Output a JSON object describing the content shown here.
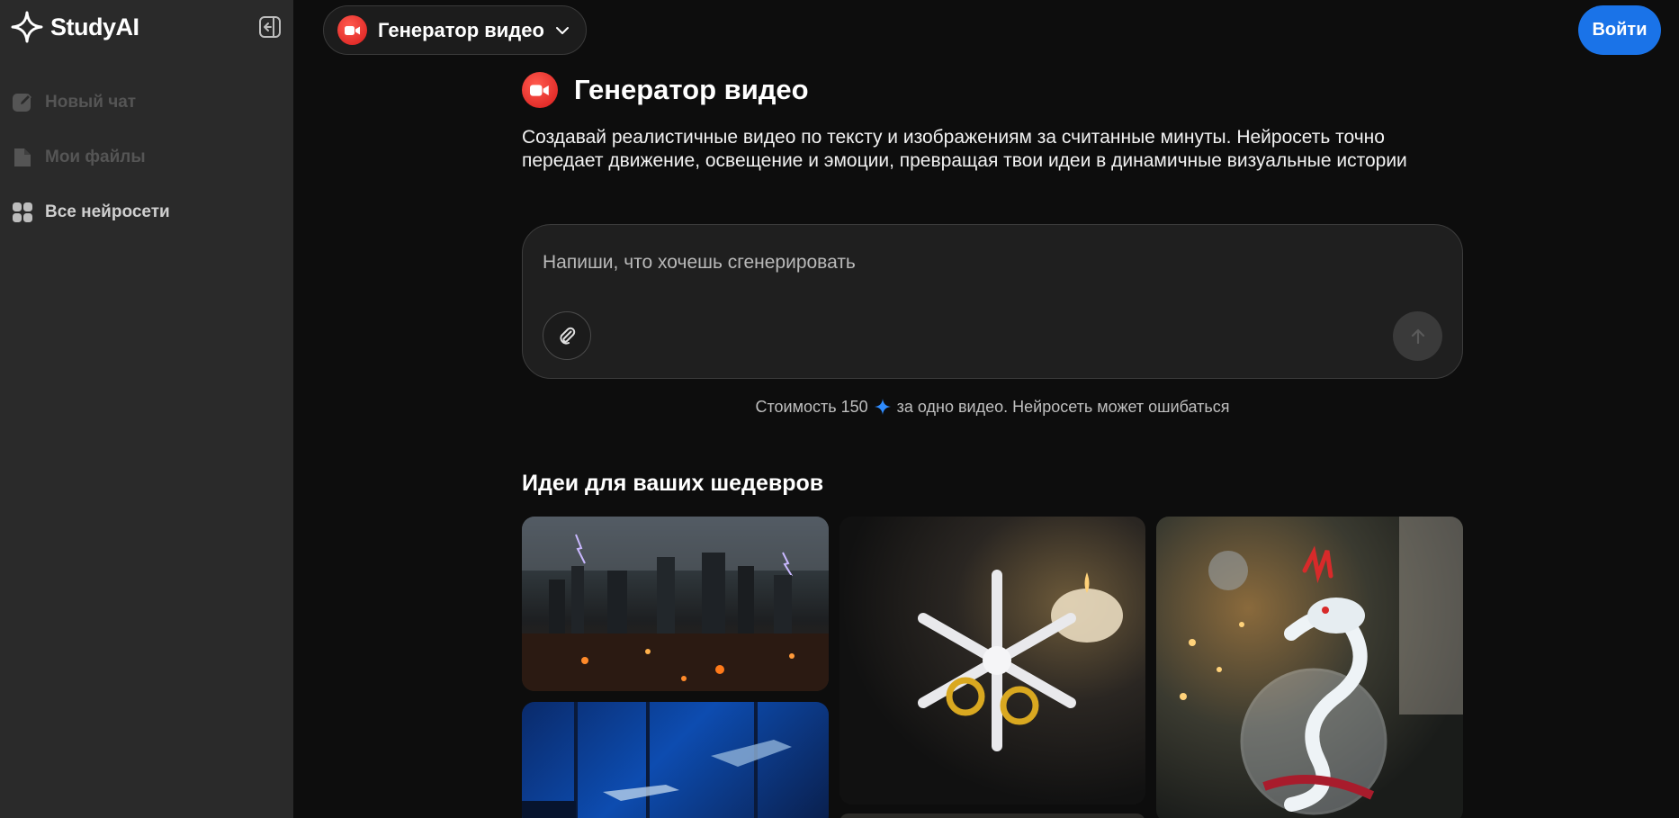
{
  "app": {
    "name": "StudyAI"
  },
  "sidebar": {
    "items": [
      {
        "label": "Новый чат",
        "icon": "edit-icon",
        "state": "disabled"
      },
      {
        "label": "Мои файлы",
        "icon": "file-icon",
        "state": "disabled"
      },
      {
        "label": "Все нейросети",
        "icon": "grid-icon",
        "state": "active"
      }
    ]
  },
  "header": {
    "model_label": "Генератор видео",
    "login_label": "Войти"
  },
  "main": {
    "title": "Генератор видео",
    "description": "Создавай реалистичные видео по тексту и изображениям за считанные минуты. Нейросеть точно передает движение, освещение и эмоции, превращая твои идеи в динамичные визуальные истории",
    "prompt": {
      "placeholder": "Напиши, что хочешь сгенерировать",
      "value": ""
    },
    "cost": {
      "prefix": "Стоимость 150",
      "suffix": "за одно видео. Нейросеть может ошибаться"
    },
    "ideas_title": "Идеи для ваших шедевров",
    "gallery": [
      {
        "name": "storm-city"
      },
      {
        "name": "shark-aquarium"
      },
      {
        "name": "jeweled-snowflake"
      },
      {
        "name": "crystal-dragon-ornament"
      }
    ]
  },
  "colors": {
    "sidebar_bg": "#2a2a2a",
    "page_bg": "#0d0d0d",
    "accent_blue": "#1a73e8",
    "record_red": "#e02424"
  }
}
